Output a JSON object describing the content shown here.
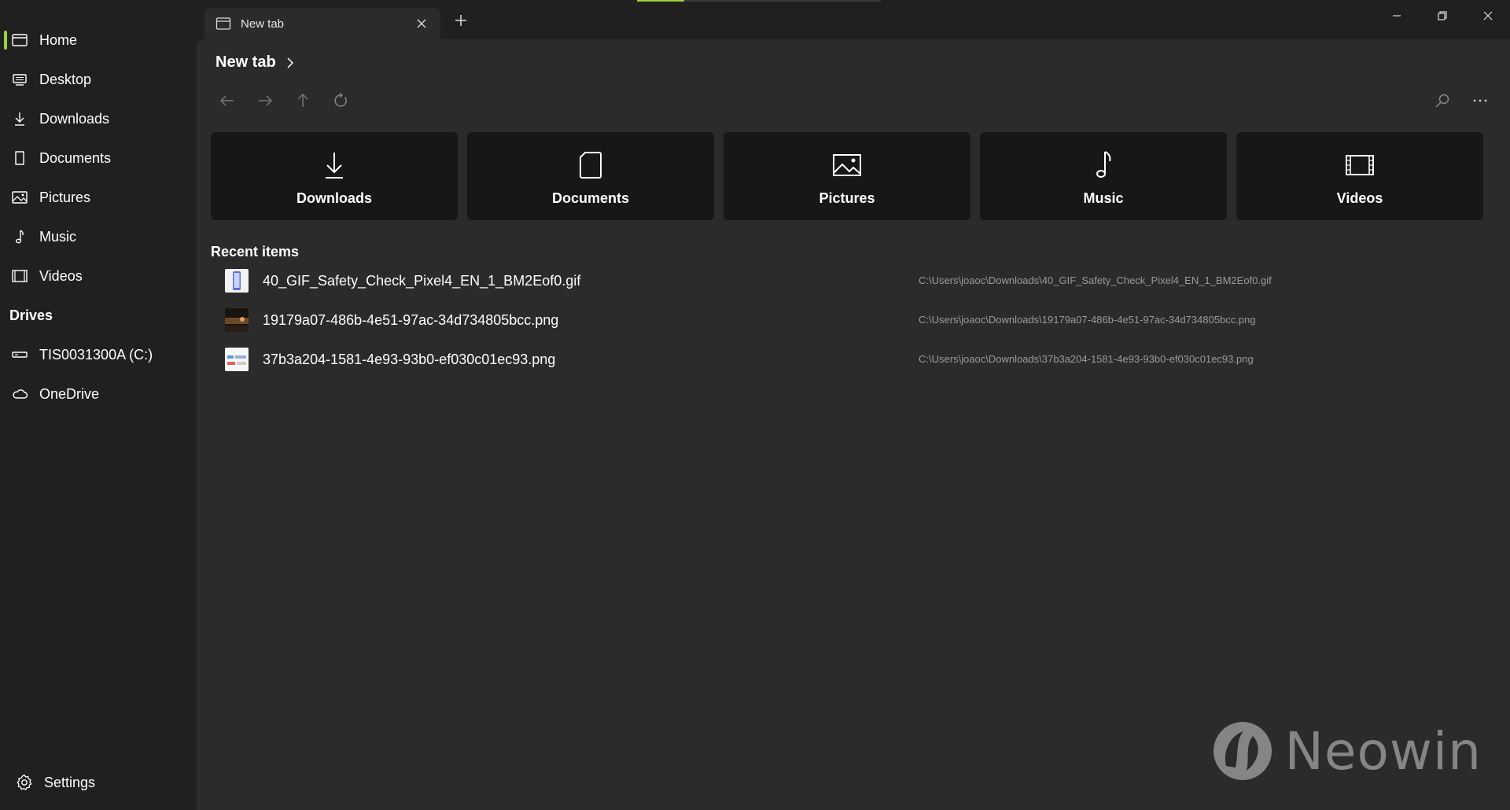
{
  "theme": {
    "accent": "#9bd33a",
    "background": "#202020",
    "content": "#2b2b2b",
    "card": "#171717"
  },
  "tab": {
    "title": "New tab"
  },
  "breadcrumb": {
    "title": "New tab"
  },
  "sidebar": {
    "items": [
      {
        "label": "Home",
        "icon": "home-icon"
      },
      {
        "label": "Desktop",
        "icon": "desktop-icon"
      },
      {
        "label": "Downloads",
        "icon": "download-icon"
      },
      {
        "label": "Documents",
        "icon": "document-icon"
      },
      {
        "label": "Pictures",
        "icon": "picture-icon"
      },
      {
        "label": "Music",
        "icon": "music-icon"
      },
      {
        "label": "Videos",
        "icon": "video-icon"
      }
    ],
    "drives_header": "Drives",
    "drives": [
      {
        "label": "TIS0031300A (C:)",
        "icon": "drive-icon"
      },
      {
        "label": "OneDrive",
        "icon": "cloud-icon"
      }
    ],
    "settings_label": "Settings"
  },
  "cards": [
    {
      "label": "Downloads",
      "icon": "download-icon"
    },
    {
      "label": "Documents",
      "icon": "document-icon"
    },
    {
      "label": "Pictures",
      "icon": "picture-icon"
    },
    {
      "label": "Music",
      "icon": "music-icon"
    },
    {
      "label": "Videos",
      "icon": "video-icon"
    }
  ],
  "recent": {
    "header": "Recent items",
    "items": [
      {
        "name": "40_GIF_Safety_Check_Pixel4_EN_1_BM2Eof0.gif",
        "path": "C:\\Users\\joaoc\\Downloads\\40_GIF_Safety_Check_Pixel4_EN_1_BM2Eof0.gif"
      },
      {
        "name": "19179a07-486b-4e51-97ac-34d734805bcc.png",
        "path": "C:\\Users\\joaoc\\Downloads\\19179a07-486b-4e51-97ac-34d734805bcc.png"
      },
      {
        "name": "37b3a204-1581-4e93-93b0-ef030c01ec93.png",
        "path": "C:\\Users\\joaoc\\Downloads\\37b3a204-1581-4e93-93b0-ef030c01ec93.png"
      }
    ]
  },
  "watermark": {
    "text": "Neowin"
  }
}
